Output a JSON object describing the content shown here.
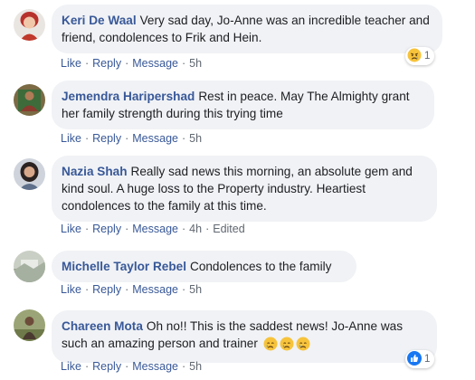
{
  "actions": {
    "like": "Like",
    "reply": "Reply",
    "message": "Message",
    "separator": "·"
  },
  "comments": [
    {
      "author": "Keri De Waal",
      "text": "Very sad day, Jo-Anne was an incredible teacher and friend, condolences to Frik and Hein.",
      "time": "5h",
      "edited": "",
      "reaction_icon": "sad-face-icon",
      "reaction_count": "1",
      "avatar_icon": "user-avatar-red-hair"
    },
    {
      "author": "Jemendra Haripershad",
      "text": "Rest in peace. May The Almighty grant her family strength during this trying time",
      "time": "5h",
      "edited": "",
      "avatar_icon": "user-avatar-framed-photo"
    },
    {
      "author": "Nazia Shah",
      "text": "Really sad news this morning, an absolute gem and kind soul. A huge loss to the Property industry. Heartiest condolences to the family at this time.",
      "time": "4h",
      "edited": "Edited",
      "avatar_icon": "user-avatar-woman"
    },
    {
      "author": "Michelle Taylor Rebel",
      "text": "Condolences to the family",
      "time": "5h",
      "edited": "",
      "avatar_icon": "user-avatar-landscape"
    },
    {
      "author": "Chareen Mota",
      "text": "Oh no!! This is the saddest news! Jo-Anne was such an amazing person and trainer",
      "inline_emojis": [
        "crying-face-icon",
        "crying-face-icon",
        "crying-face-icon"
      ],
      "time": "5h",
      "edited": "",
      "reaction_icon": "like-thumb-icon",
      "reaction_count": "1",
      "avatar_icon": "user-avatar-outdoor"
    }
  ],
  "colors": {
    "bubble": "#f0f2f5",
    "author": "#385898",
    "meta": "#606770",
    "like_blue": "#1877f2",
    "emoji_yellow": "#f7c33b"
  }
}
